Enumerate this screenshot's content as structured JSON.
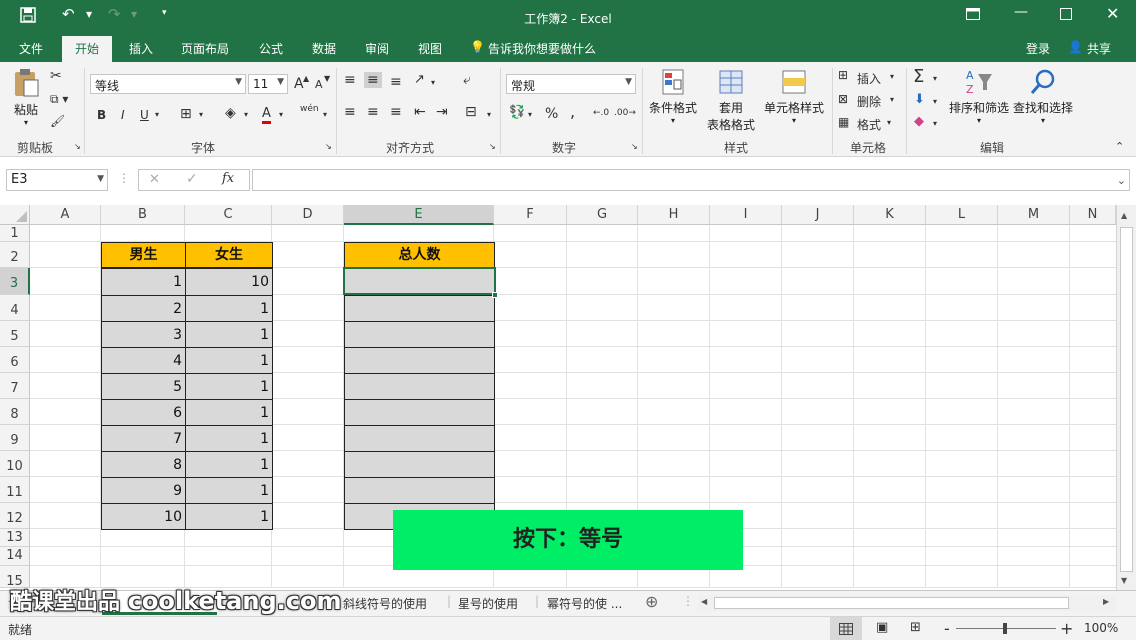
{
  "window": {
    "title": "工作簿2 - Excel"
  },
  "quick_access": {
    "save_icon": "save-icon",
    "undo_icon": "undo-icon",
    "redo_icon": "redo-icon",
    "customize_icon": "customize-icon"
  },
  "window_controls": [
    "ribbon-display-icon",
    "minimize-icon",
    "maximize-icon",
    "close-icon"
  ],
  "tabs": [
    "文件",
    "开始",
    "插入",
    "页面布局",
    "公式",
    "数据",
    "审阅",
    "视图"
  ],
  "tell_me": "告诉我你想要做什么",
  "login": "登录",
  "share": "共享",
  "ribbon": {
    "clipboard": {
      "paste": "粘贴",
      "label": "剪贴板"
    },
    "font": {
      "name": "等线",
      "size": "11",
      "bold": "B",
      "italic": "I",
      "underline": "U",
      "grow": "A",
      "shrink": "A",
      "color_a": "A",
      "wen": "wén",
      "label": "字体"
    },
    "alignment": {
      "label": "对齐方式"
    },
    "number": {
      "format": "常规",
      "percent": "%",
      "comma": ",",
      "label": "数字"
    },
    "styles": {
      "conditional": "条件格式",
      "table1": "套用",
      "table2": "表格格式",
      "cell_styles": "单元格样式",
      "label": "样式"
    },
    "cells": {
      "insert": "插入",
      "delete": "删除",
      "format": "格式",
      "label": "单元格"
    },
    "editing": {
      "sort": "排序和筛选",
      "find": "查找和选择",
      "label": "编辑"
    }
  },
  "formula_bar": {
    "name_box": "E3",
    "cancel": "✕",
    "enter": "✓",
    "fx": "fx",
    "value": ""
  },
  "columns": [
    "A",
    "B",
    "C",
    "D",
    "E",
    "F",
    "G",
    "H",
    "I",
    "J",
    "K",
    "L",
    "M",
    "N"
  ],
  "rows": [
    "1",
    "2",
    "3",
    "4",
    "5",
    "6",
    "7",
    "8",
    "9",
    "10",
    "11",
    "12",
    "13",
    "14",
    "15"
  ],
  "table": {
    "header_b": "男生",
    "header_c": "女生",
    "header_e": "总人数",
    "b_values": [
      "1",
      "2",
      "3",
      "4",
      "5",
      "6",
      "7",
      "8",
      "9",
      "10"
    ],
    "c_values": [
      "10",
      "1",
      "1",
      "1",
      "1",
      "1",
      "1",
      "1",
      "1",
      "1"
    ],
    "header_color": "#ffc000",
    "cell_color": "#d9d9d9"
  },
  "overlay": {
    "text": "按下：等号",
    "color": "#00ee66"
  },
  "sheets": [
    "斜线符号的使用",
    "星号的使用",
    "幂符号的使 ..."
  ],
  "watermark": {
    "brand": "酷课堂出品",
    "domain": "coolketang.com"
  },
  "status": {
    "ready": "就绪",
    "zoom": "100%",
    "zoom_minus": "-",
    "zoom_plus": "+"
  }
}
